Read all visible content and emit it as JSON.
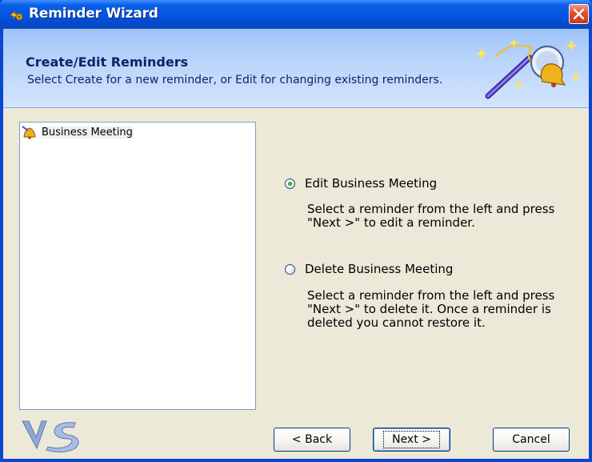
{
  "window": {
    "title": "Reminder Wizard"
  },
  "header": {
    "title": "Create/Edit Reminders",
    "subtitle": "Select Create for a new reminder, or Edit for changing existing reminders."
  },
  "list": {
    "items": [
      {
        "label": "Business Meeting",
        "icon": "bell-icon"
      }
    ]
  },
  "options": [
    {
      "label": "Edit Business Meeting",
      "checked": true,
      "description": "Select a reminder from the left and press \"Next >\" to edit a reminder."
    },
    {
      "label": "Delete Business Meeting",
      "checked": false,
      "description": "Select a reminder from the left and press \"Next >\" to delete it.  Once a reminder is deleted you cannot restore it."
    }
  ],
  "buttons": {
    "back": "< Back",
    "next": "Next >",
    "cancel": "Cancel"
  },
  "colors": {
    "titlebar": "#0554e3",
    "header": "#b9d4fa",
    "window": "#ece9d8",
    "close": "#e0502a"
  }
}
